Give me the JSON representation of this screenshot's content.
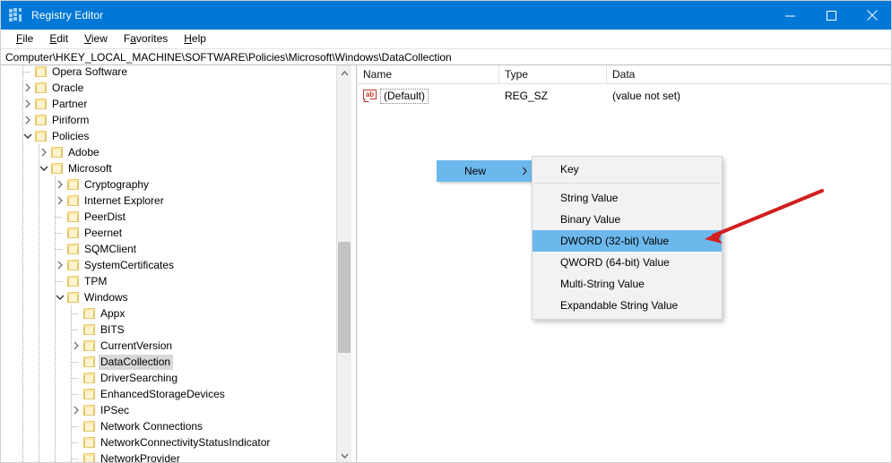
{
  "window": {
    "title": "Registry Editor",
    "app_icon": "registry-editor-icon",
    "controls": {
      "minimize": "minimize-icon",
      "maximize": "maximize-icon",
      "close": "close-icon"
    }
  },
  "menubar": {
    "items": [
      {
        "label": "File",
        "accesskey": "F"
      },
      {
        "label": "Edit",
        "accesskey": "E"
      },
      {
        "label": "View",
        "accesskey": "V"
      },
      {
        "label": "Favorites",
        "accesskey": "a"
      },
      {
        "label": "Help",
        "accesskey": "H"
      }
    ]
  },
  "address": {
    "path": "Computer\\HKEY_LOCAL_MACHINE\\SOFTWARE\\Policies\\Microsoft\\Windows\\DataCollection"
  },
  "tree": {
    "items": [
      {
        "label": "Opera Software",
        "depth": 1,
        "expander": "none",
        "selected": false
      },
      {
        "label": "Oracle",
        "depth": 1,
        "expander": "collapsed",
        "selected": false
      },
      {
        "label": "Partner",
        "depth": 1,
        "expander": "collapsed",
        "selected": false
      },
      {
        "label": "Piriform",
        "depth": 1,
        "expander": "collapsed",
        "selected": false
      },
      {
        "label": "Policies",
        "depth": 1,
        "expander": "expanded",
        "selected": false
      },
      {
        "label": "Adobe",
        "depth": 2,
        "expander": "collapsed",
        "selected": false
      },
      {
        "label": "Microsoft",
        "depth": 2,
        "expander": "expanded",
        "selected": false
      },
      {
        "label": "Cryptography",
        "depth": 3,
        "expander": "collapsed",
        "selected": false
      },
      {
        "label": "Internet Explorer",
        "depth": 3,
        "expander": "collapsed",
        "selected": false
      },
      {
        "label": "PeerDist",
        "depth": 3,
        "expander": "none",
        "selected": false
      },
      {
        "label": "Peernet",
        "depth": 3,
        "expander": "none",
        "selected": false
      },
      {
        "label": "SQMClient",
        "depth": 3,
        "expander": "none",
        "selected": false
      },
      {
        "label": "SystemCertificates",
        "depth": 3,
        "expander": "collapsed",
        "selected": false
      },
      {
        "label": "TPM",
        "depth": 3,
        "expander": "none",
        "selected": false
      },
      {
        "label": "Windows",
        "depth": 3,
        "expander": "expanded",
        "selected": false
      },
      {
        "label": "Appx",
        "depth": 4,
        "expander": "none",
        "selected": false
      },
      {
        "label": "BITS",
        "depth": 4,
        "expander": "none",
        "selected": false
      },
      {
        "label": "CurrentVersion",
        "depth": 4,
        "expander": "collapsed",
        "selected": false
      },
      {
        "label": "DataCollection",
        "depth": 4,
        "expander": "none",
        "selected": true
      },
      {
        "label": "DriverSearching",
        "depth": 4,
        "expander": "none",
        "selected": false
      },
      {
        "label": "EnhancedStorageDevices",
        "depth": 4,
        "expander": "none",
        "selected": false
      },
      {
        "label": "IPSec",
        "depth": 4,
        "expander": "collapsed",
        "selected": false
      },
      {
        "label": "Network Connections",
        "depth": 4,
        "expander": "none",
        "selected": false
      },
      {
        "label": "NetworkConnectivityStatusIndicator",
        "depth": 4,
        "expander": "none",
        "selected": false
      },
      {
        "label": "NetworkProvider",
        "depth": 4,
        "expander": "none",
        "selected": false
      }
    ]
  },
  "listview": {
    "columns": [
      "Name",
      "Type",
      "Data"
    ],
    "rows": [
      {
        "icon": "string-value-icon",
        "name": "(Default)",
        "type": "REG_SZ",
        "data": "(value not set)"
      }
    ]
  },
  "context_menu": {
    "parent_label": "New",
    "parent_arrow": "chevron-right-icon",
    "submenu": [
      {
        "label": "Key",
        "highlighted": false,
        "separator_after": true
      },
      {
        "label": "String Value",
        "highlighted": false,
        "separator_after": false
      },
      {
        "label": "Binary Value",
        "highlighted": false,
        "separator_after": false
      },
      {
        "label": "DWORD (32-bit) Value",
        "highlighted": true,
        "separator_after": false
      },
      {
        "label": "QWORD (64-bit) Value",
        "highlighted": false,
        "separator_after": false
      },
      {
        "label": "Multi-String Value",
        "highlighted": false,
        "separator_after": false
      },
      {
        "label": "Expandable String Value",
        "highlighted": false,
        "separator_after": false
      }
    ]
  },
  "annotation": {
    "type": "arrow",
    "color": "#d21f1f",
    "points_to": "DWORD (32-bit) Value"
  },
  "colors": {
    "titlebar": "#0078d7",
    "menu_highlight": "#6cb8ec",
    "tree_selection": "#d8d8d8",
    "folder": "#fde8a6",
    "annotation": "#d21f1f"
  },
  "scrollbar": {
    "up_arrow": "chevron-up-icon",
    "down_arrow": "chevron-down-icon"
  }
}
